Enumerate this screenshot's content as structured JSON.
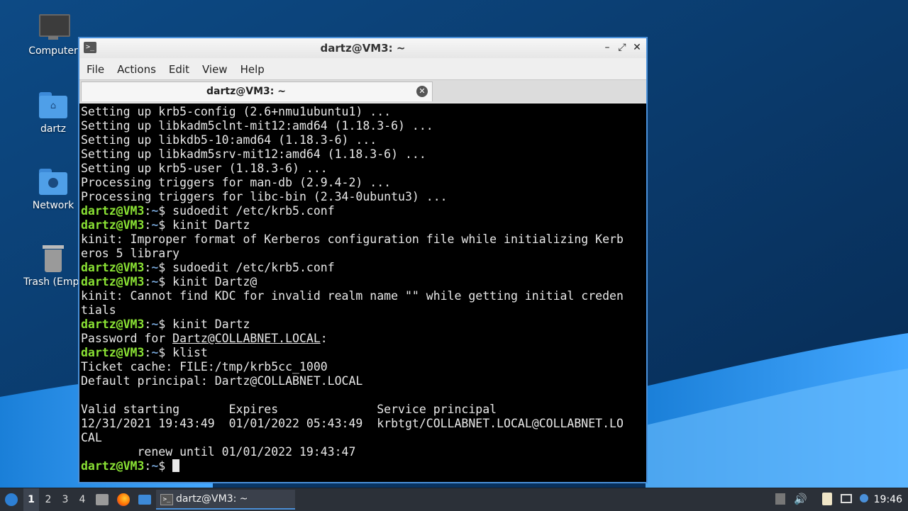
{
  "desktop": {
    "icons": [
      {
        "label": "Computer"
      },
      {
        "label": "dartz"
      },
      {
        "label": "Network"
      },
      {
        "label": "Trash (Empt"
      }
    ]
  },
  "window": {
    "title": "dartz@VM3: ~",
    "menu": [
      "File",
      "Actions",
      "Edit",
      "View",
      "Help"
    ],
    "tab_label": "dartz@VM3: ~"
  },
  "terminal": {
    "prompt_user": "dartz@VM3",
    "prompt_path": "~",
    "lines": [
      {
        "type": "out",
        "text": "Setting up krb5-config (2.6+nmu1ubuntu1) ..."
      },
      {
        "type": "out",
        "text": "Setting up libkadm5clnt-mit12:amd64 (1.18.3-6) ..."
      },
      {
        "type": "out",
        "text": "Setting up libkdb5-10:amd64 (1.18.3-6) ..."
      },
      {
        "type": "out",
        "text": "Setting up libkadm5srv-mit12:amd64 (1.18.3-6) ..."
      },
      {
        "type": "out",
        "text": "Setting up krb5-user (1.18.3-6) ..."
      },
      {
        "type": "out",
        "text": "Processing triggers for man-db (2.9.4-2) ..."
      },
      {
        "type": "out",
        "text": "Processing triggers for libc-bin (2.34-0ubuntu3) ..."
      },
      {
        "type": "cmd",
        "text": "sudoedit /etc/krb5.conf"
      },
      {
        "type": "cmd",
        "text": "kinit Dartz"
      },
      {
        "type": "out",
        "text": "kinit: Improper format of Kerberos configuration file while initializing Kerb"
      },
      {
        "type": "out",
        "text": "eros 5 library"
      },
      {
        "type": "cmd",
        "text": "sudoedit /etc/krb5.conf"
      },
      {
        "type": "cmd",
        "text": "kinit Dartz@"
      },
      {
        "type": "out",
        "text": "kinit: Cannot find KDC for invalid realm name \"\" while getting initial creden"
      },
      {
        "type": "out",
        "text": "tials"
      },
      {
        "type": "cmd",
        "text": "kinit Dartz"
      },
      {
        "type": "pw",
        "prefix": "Password for ",
        "link": "Dartz@COLLABNET.LOCAL",
        "suffix": ":"
      },
      {
        "type": "cmd",
        "text": "klist"
      },
      {
        "type": "out",
        "text": "Ticket cache: FILE:/tmp/krb5cc_1000"
      },
      {
        "type": "out",
        "text": "Default principal: Dartz@COLLABNET.LOCAL"
      },
      {
        "type": "out",
        "text": ""
      },
      {
        "type": "out",
        "text": "Valid starting       Expires              Service principal"
      },
      {
        "type": "out",
        "text": "12/31/2021 19:43:49  01/01/2022 05:43:49  krbtgt/COLLABNET.LOCAL@COLLABNET.LO"
      },
      {
        "type": "out",
        "text": "CAL"
      },
      {
        "type": "out",
        "text": "        renew until 01/01/2022 19:43:47"
      },
      {
        "type": "cursor",
        "text": ""
      }
    ]
  },
  "taskbar": {
    "workspaces": [
      "1",
      "2",
      "3",
      "4"
    ],
    "active_workspace": "1",
    "task_label": "dartz@VM3: ~",
    "clock": "19:46"
  }
}
